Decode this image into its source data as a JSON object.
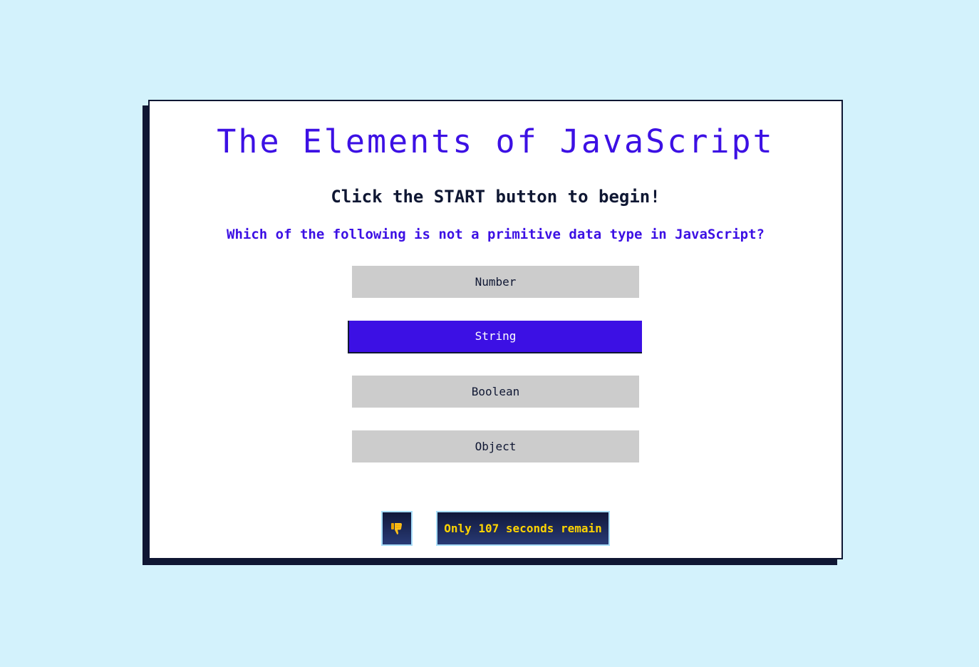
{
  "app": {
    "title": "The Elements of JavaScript",
    "instruction": "Click the START button to begin!"
  },
  "quiz": {
    "question": "Which of the following is not a primitive data type in JavaScript?",
    "answers": [
      {
        "label": "Number",
        "selected": false
      },
      {
        "label": "String",
        "selected": true
      },
      {
        "label": "Boolean",
        "selected": false
      },
      {
        "label": "Object",
        "selected": false
      }
    ]
  },
  "status": {
    "feedback_icon": "thumbs-down-icon",
    "timer_text": "Only 107 seconds remain"
  },
  "colors": {
    "accent": "#3c10e4",
    "background": "#d3f2fc",
    "dark": "#0f1733",
    "answer_default": "#cccccc",
    "timer_text": "#ffd400"
  }
}
